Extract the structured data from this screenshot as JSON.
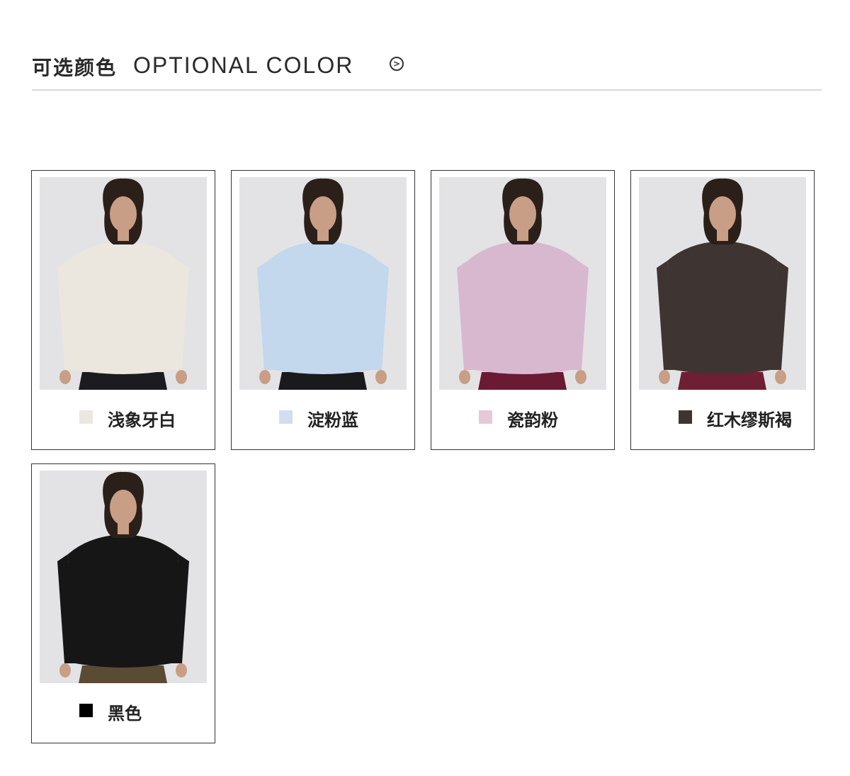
{
  "header": {
    "title_cn": "可选颜色",
    "title_en": "OPTIONAL COLOR",
    "next_icon": "circle-chevron-right-icon"
  },
  "colors": [
    {
      "name": "浅象牙白",
      "swatch": "#ebe8e2",
      "shirt": "#ebe7df",
      "pants": "#1c1c20"
    },
    {
      "name": "淀粉蓝",
      "swatch": "#cfdff0",
      "shirt": "#c3d7ed",
      "pants": "#1a1a1c"
    },
    {
      "name": "瓷韵粉",
      "swatch": "#e6c9d7",
      "shirt": "#d8b8cf",
      "pants": "#6b1a33"
    },
    {
      "name": "红木缪斯褐",
      "swatch": "#3e3431",
      "shirt": "#3e3532",
      "pants": "#6f1f33"
    },
    {
      "name": "黑色",
      "swatch": "#000000",
      "shirt": "#161616",
      "pants": "#5a4b35"
    }
  ]
}
